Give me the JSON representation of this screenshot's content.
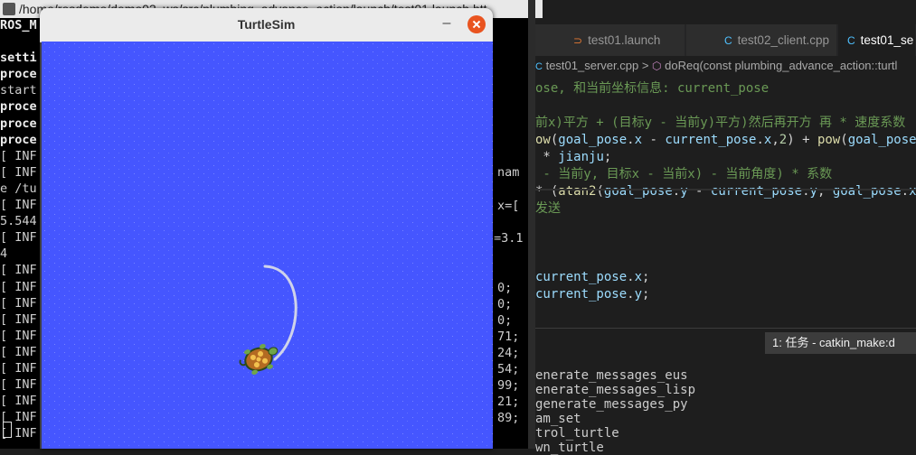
{
  "terminal": {
    "title": "/home/rosdemo/demo03_ws/src/plumbing_advance_action/launch/test01.launch htt",
    "lines": [
      {
        "text": "ROS_M",
        "bold": true
      },
      {
        "text": "",
        "bold": false
      },
      {
        "text": "setti",
        "bold": true
      },
      {
        "text": "proce",
        "bold": true
      },
      {
        "text": "start",
        "bold": false
      },
      {
        "text": "proce",
        "bold": true
      },
      {
        "text": "proce",
        "bold": true
      },
      {
        "text": "proce",
        "bold": true
      },
      {
        "text": "[ INF",
        "bold": false
      },
      {
        "text": "[ INF",
        "bold": false
      },
      {
        "text": "e /tu",
        "bold": false
      },
      {
        "text": "[ INF",
        "bold": false
      },
      {
        "text": "5.544",
        "bold": false
      },
      {
        "text": "[ INF",
        "bold": false
      },
      {
        "text": "4",
        "bold": false
      },
      {
        "text": "[ INF",
        "bold": false
      },
      {
        "text": "[ INF",
        "bold": false
      },
      {
        "text": "[ INF",
        "bold": false
      },
      {
        "text": "[ INF",
        "bold": false
      },
      {
        "text": "[ INF",
        "bold": false
      },
      {
        "text": "[ INF",
        "bold": false
      },
      {
        "text": "[ INF",
        "bold": false
      },
      {
        "text": "[ INF",
        "bold": false
      },
      {
        "text": "[ INF",
        "bold": false
      },
      {
        "text": "[ INF",
        "bold": false
      },
      {
        "text": "[ INF",
        "bold": false
      }
    ],
    "right_fragments": [
      "nam",
      "x=[",
      "=3.1",
      "0;",
      "0;",
      "0;",
      "71;",
      "24;",
      "54;",
      "99;",
      "21;",
      "89;"
    ]
  },
  "vscode": {
    "tabs": [
      {
        "label": "test01.launch",
        "icon": "rss-icon",
        "active": false
      },
      {
        "label": "test02_client.cpp",
        "icon": "cpp-icon",
        "active": false
      },
      {
        "label": "test01_se",
        "icon": "cpp-icon",
        "active": true
      }
    ],
    "breadcrumb": {
      "file": "test01_server.cpp",
      "separator": ">",
      "symbol": "doReq(const plumbing_advance_action::turtl"
    },
    "code_lines": [
      {
        "text": "ose, 和当前坐标信息: current_pose",
        "cls": "cm",
        "row": 0
      },
      {
        "text": "前x)平方 + (目标y - 当前y)平方)然后再开方 再 * 速度系数",
        "cls": "cm",
        "row": 2
      },
      {
        "text": "ow(goal_pose.x - current_pose.x,2) + pow(goal_pose",
        "cls": "code",
        "row": 3
      },
      {
        "text": " * jianju;",
        "cls": "code",
        "row": 4
      },
      {
        "text": " - 当前y, 目标x - 当前x) - 当前角度) * 系数",
        "cls": "cm",
        "row": 5
      },
      {
        "text": "* (atan2(goal_pose.y - current_pose.y, goal_pose.x",
        "cls": "code",
        "row": 6
      },
      {
        "text": "发送",
        "cls": "cm",
        "row": 7
      },
      {
        "text": "current_pose.x;",
        "cls": "code",
        "row": 11
      },
      {
        "text": "current_pose.y;",
        "cls": "code",
        "row": 12
      }
    ],
    "panel": {
      "task_select": "1: 任务 - catkin_make:d",
      "lines": [
        "enerate_messages_eus",
        "enerate_messages_lisp",
        "generate_messages_py",
        "am_set",
        "trol_turtle",
        "wn_turtle"
      ]
    }
  },
  "turtlesim": {
    "title": "TurtleSim",
    "minimize_label": "–",
    "background_color": "#4556ff",
    "trail_color": "#cfd3ea"
  }
}
